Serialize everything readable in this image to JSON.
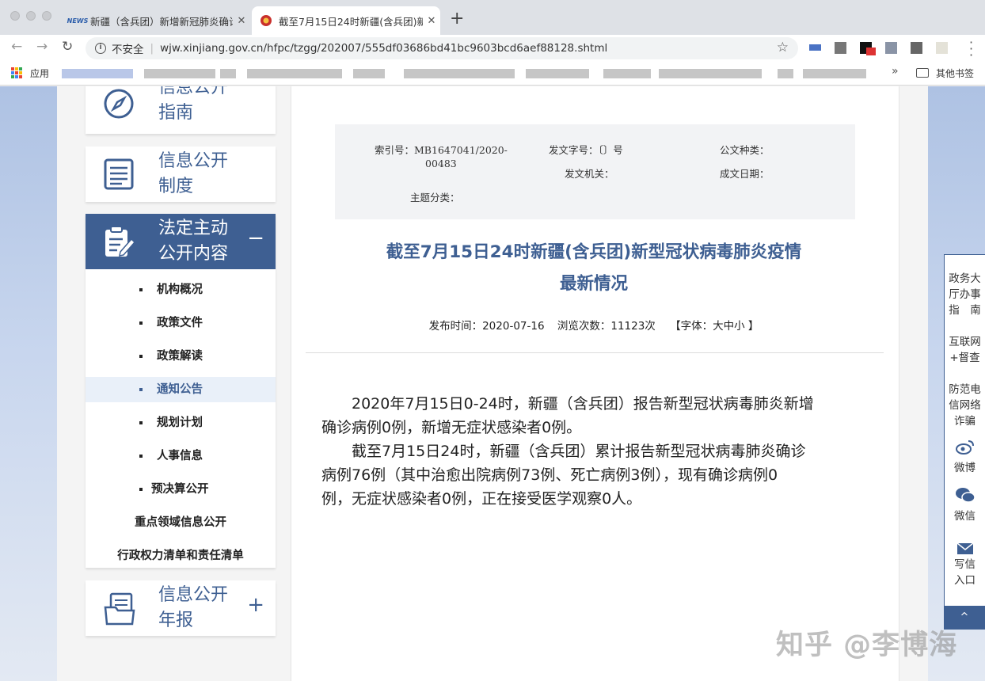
{
  "browser": {
    "tabs": [
      {
        "favicon_text": "NEWS",
        "title": "新疆（含兵团）新增新冠肺炎确诊",
        "active": false
      },
      {
        "favicon_text": "",
        "title": "截至7月15日24时新疆(含兵团)新",
        "active": true
      }
    ],
    "new_tab": "+",
    "close_glyph": "✕",
    "security_label": "不安全",
    "url": "wjw.xinjiang.gov.cn/hfpc/tzgg/202007/555df03686bd41bc9603bcd6aef88128.shtml",
    "bookmarks": {
      "apps_label": "应用",
      "other_label": "其他书签"
    }
  },
  "sidebar": {
    "cards": [
      {
        "line1": "信息公开",
        "line2": "指南",
        "icon": "compass-icon"
      },
      {
        "line1": "信息公开",
        "line2": "制度",
        "icon": "list-doc-icon"
      },
      {
        "line1": "法定主动",
        "line2": "公开内容",
        "icon": "edit-doc-icon",
        "toggle": "−"
      },
      {
        "line1": "信息公开",
        "line2": "年报",
        "icon": "folder-doc-icon",
        "toggle": "+"
      }
    ],
    "submenu": [
      "机构概况",
      "政策文件",
      "政策解读",
      "通知公告",
      "规划计划",
      "人事信息",
      "预决算公开",
      "重点领域信息公开",
      "行政权力清单和责任清单"
    ],
    "current_item": "通知公告"
  },
  "meta": {
    "index_label": "索引号：MB1647041/2020-",
    "index_cont": "00483",
    "doc_no": "发文字号：〔〕号",
    "doc_type": "公文种类：",
    "issuer": "发文机关：",
    "date": "成文日期：",
    "topic": "主题分类："
  },
  "article": {
    "title_line1": "截至7月15日24时新疆(含兵团)新型冠状病毒肺炎疫情",
    "title_line2": "最新情况",
    "publish_label": "发布时间：",
    "publish_date": "2020-07-16",
    "views_label": "浏览次数：",
    "views": "11123次",
    "font_label": "【字体：大中小 】",
    "p1_line1": "　　2020年7月15日0-24时，新疆（含兵团）报告新型冠状病毒肺炎新增",
    "p1_line2": "确诊病例0例，新增无症状感染者0例。",
    "p2_line1": "　　截至7月15日24时，新疆（含兵团）累计报告新型冠状病毒肺炎确诊",
    "p2_line2": "病例76例（其中治愈出院病例73例、死亡病例3例），现有确诊病例0",
    "p2_line3": "例，无症状感染者0例，正在接受医学观察0人。"
  },
  "floatbar": {
    "guide": [
      "政务大",
      "厅办事",
      "指　南"
    ],
    "supervise": [
      "互联网",
      "+督查"
    ],
    "fraud": [
      "防范电",
      "信网络",
      "诈骗"
    ],
    "weibo": "微博",
    "wechat": "微信",
    "mail": [
      "写信",
      "入口"
    ],
    "top": "^"
  },
  "watermark": "知乎 @李博海",
  "colors": {
    "brand": "#3e5f92",
    "page_bg": "#aec2e3"
  }
}
